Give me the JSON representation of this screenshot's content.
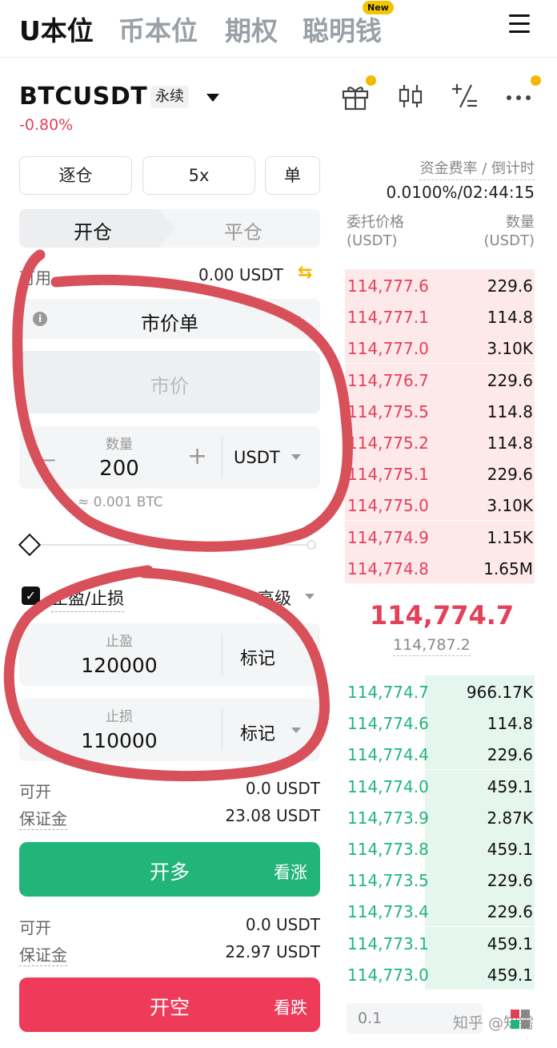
{
  "top_tabs": [
    {
      "label": "U本位",
      "active": true
    },
    {
      "label": "币本位",
      "active": false
    },
    {
      "label": "期权",
      "active": false
    },
    {
      "label": "聪明钱",
      "active": false
    }
  ],
  "new_badge": "New",
  "header": {
    "symbol": "BTCUSDT",
    "contract_type": "永续",
    "change": "-0.80%"
  },
  "settings": {
    "margin_mode": "逐仓",
    "leverage": "5x",
    "position_mode": "单"
  },
  "funding": {
    "label": "资金费率 / 倒计时",
    "value": "0.0100%/02:44:15"
  },
  "order_tabs": {
    "open": "开仓",
    "close": "平仓"
  },
  "available": {
    "label": "可用",
    "value": "0.00 USDT"
  },
  "order_type": "市价单",
  "price_placeholder": "市价",
  "quantity": {
    "label": "数量",
    "value": "200",
    "unit": "USDT",
    "approx": "≈ 0.001 BTC"
  },
  "slider_value_percent": 0,
  "tpsl": {
    "checked": true,
    "label": "止盈/止损",
    "advanced": "高级",
    "take_profit": {
      "label": "止盈",
      "value": "120000",
      "trigger": "标记"
    },
    "stop_loss": {
      "label": "止损",
      "value": "110000",
      "trigger": "标记"
    }
  },
  "long_info": {
    "can_open_label": "可开",
    "can_open": "0.0 USDT",
    "margin_label": "保证金",
    "margin": "23.08 USDT"
  },
  "long_button": {
    "label": "开多",
    "sub": "看涨"
  },
  "short_info": {
    "can_open_label": "可开",
    "can_open": "0.0 USDT",
    "margin_label": "保证金",
    "margin": "22.97 USDT"
  },
  "short_button": {
    "label": "开空",
    "sub": "看跌"
  },
  "orderbook": {
    "price_header": "委托价格",
    "qty_header": "数量",
    "unit": "(USDT)",
    "asks": [
      {
        "price": "114,777.6",
        "qty": "229.6"
      },
      {
        "price": "114,777.1",
        "qty": "114.8"
      },
      {
        "price": "114,777.0",
        "qty": "3.10K"
      },
      {
        "price": "114,776.7",
        "qty": "229.6"
      },
      {
        "price": "114,775.5",
        "qty": "114.8"
      },
      {
        "price": "114,775.2",
        "qty": "114.8"
      },
      {
        "price": "114,775.1",
        "qty": "229.6"
      },
      {
        "price": "114,775.0",
        "qty": "3.10K"
      },
      {
        "price": "114,774.9",
        "qty": "1.15K"
      },
      {
        "price": "114,774.8",
        "qty": "1.65M"
      }
    ],
    "last_price": "114,774.7",
    "mark_price": "114,787.2",
    "bids": [
      {
        "price": "114,774.7",
        "qty": "966.17K"
      },
      {
        "price": "114,774.6",
        "qty": "114.8"
      },
      {
        "price": "114,774.4",
        "qty": "229.6"
      },
      {
        "price": "114,774.0",
        "qty": "459.1"
      },
      {
        "price": "114,773.9",
        "qty": "2.87K"
      },
      {
        "price": "114,773.8",
        "qty": "459.1"
      },
      {
        "price": "114,773.5",
        "qty": "229.6"
      },
      {
        "price": "114,773.4",
        "qty": "229.6"
      },
      {
        "price": "114,773.1",
        "qty": "459.1"
      },
      {
        "price": "114,773.0",
        "qty": "459.1"
      }
    ],
    "precision": "0.1"
  },
  "watermark": "知乎 @知需",
  "colors": {
    "up": "#21b57a",
    "down": "#e4405a",
    "accent": "#f5b800",
    "annotation": "#d8505a"
  },
  "icons": [
    "gift-icon",
    "candlestick-icon",
    "calculator-icon",
    "more-icon",
    "swap-icon",
    "info-icon"
  ]
}
